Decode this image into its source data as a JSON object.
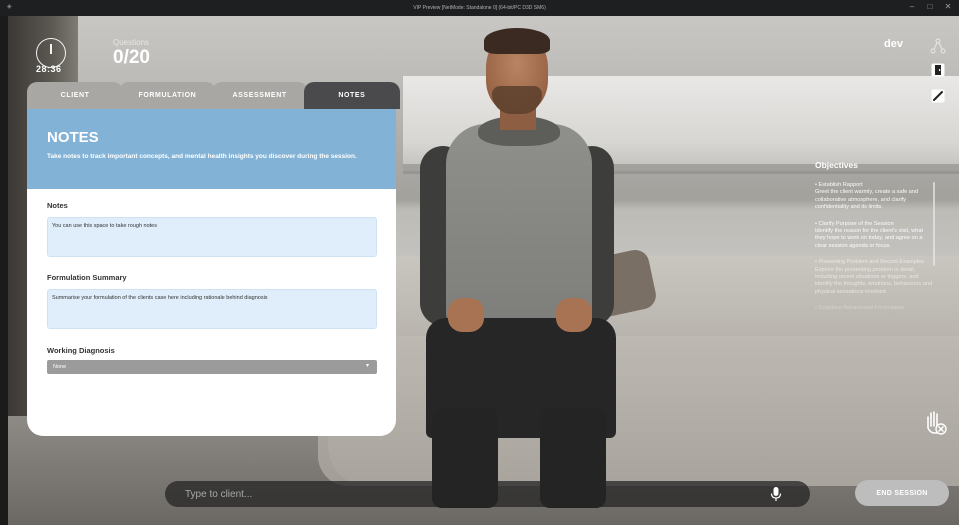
{
  "window": {
    "title": "VIP Preview [NetMode: Standalone 0] (64-bit/PC D3D SM6)",
    "app_icon": "app-icon",
    "controls": [
      "–",
      "□",
      "✕"
    ]
  },
  "hud": {
    "timer": "28:36",
    "questions_label": "Questions",
    "questions_value": "0/20"
  },
  "panel": {
    "tabs": [
      {
        "label": "CLIENT",
        "active": false
      },
      {
        "label": "FORMULATION",
        "active": false
      },
      {
        "label": "ASSESSMENT",
        "active": false
      },
      {
        "label": "NOTES",
        "active": true
      }
    ],
    "header_title": "NOTES",
    "header_subtitle": "Take notes to track important concepts, and mental health insights you discover during the session.",
    "notes_label": "Notes",
    "notes_placeholder": "You can use this space to take rough notes",
    "summary_label": "Formulation Summary",
    "summary_placeholder": "Summarise your formulation of the clients case here including rationale behind diagnosis",
    "diagnosis_label": "Working Diagnosis",
    "diagnosis_value": "None"
  },
  "top_right": {
    "user": "dev",
    "icons": [
      "share-icon",
      "exit-icon",
      "pen-icon"
    ]
  },
  "objectives": {
    "title": "Objectives",
    "items": [
      "• Establish Rapport\nGreet the client warmly, create a safe and collaborative atmosphere, and clarify confidentiality and its limits.",
      "• Clarify Purpose of the Session\nIdentify the reason for the client's visit, what they hope to work on today, and agree on a clear session agenda or focus.",
      "• Presenting Problem and Recent Examples\nExplore the presenting problem in detail, including recent situations or triggers, and identify the thoughts, emotions, behaviours and physical sensations involved.",
      "• Cognitive Behavioural Formulation"
    ]
  },
  "chat": {
    "placeholder": "Type to client..."
  },
  "end_session_label": "END SESSION",
  "colors": {
    "header_blue": "#82b3d6",
    "field_blue": "#dfeefa",
    "tab_active": "#4a4a4c",
    "tab_inactive": "#a9a7a4"
  }
}
